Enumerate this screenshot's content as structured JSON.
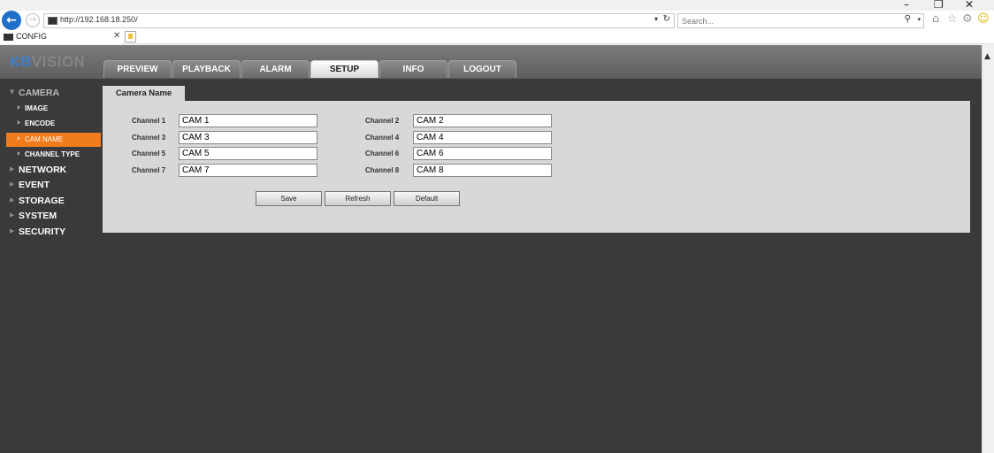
{
  "browser": {
    "url": "http://192.168.18.250/",
    "search_placeholder": "Search...",
    "tab_title": "CONFIG",
    "window_controls": [
      "–",
      "❐",
      "✕"
    ]
  },
  "app": {
    "logo_a": "KB",
    "logo_b": "VISION",
    "brand_color": "#3b7fcf",
    "accent_color": "#f07c1e",
    "nav_tabs": [
      "PREVIEW",
      "PLAYBACK",
      "ALARM",
      "SETUP",
      "INFO",
      "LOGOUT"
    ],
    "active_tab": "SETUP"
  },
  "sidebar": {
    "camera": "CAMERA",
    "image": "IMAGE",
    "encode": "ENCODE",
    "cam_name": "CAM NAME",
    "channel_type": "CHANNEL TYPE",
    "network": "NETWORK",
    "event": "EVENT",
    "storage": "STORAGE",
    "system": "SYSTEM",
    "security": "SECURITY"
  },
  "panel": {
    "title": "Camera Name",
    "channels": [
      {
        "label": "Channel 1",
        "value": "CAM 1"
      },
      {
        "label": "Channel 2",
        "value": "CAM 2"
      },
      {
        "label": "Channel 3",
        "value": "CAM 3"
      },
      {
        "label": "Channel 4",
        "value": "CAM 4"
      },
      {
        "label": "Channel 5",
        "value": "CAM 5"
      },
      {
        "label": "Channel 6",
        "value": "CAM 6"
      },
      {
        "label": "Channel 7",
        "value": "CAM 7"
      },
      {
        "label": "Channel 8",
        "value": "CAM 8"
      }
    ],
    "save": "Save",
    "refresh": "Refresh",
    "default": "Default"
  }
}
